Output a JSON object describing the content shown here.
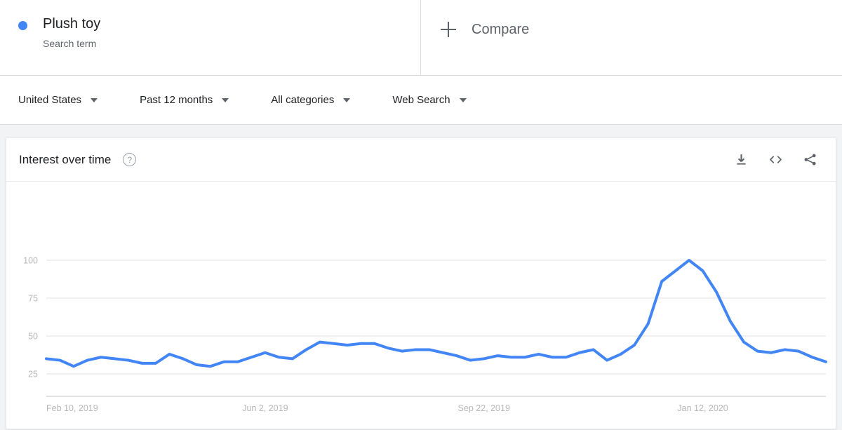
{
  "term": {
    "name": "Plush toy",
    "subtitle": "Search term",
    "dot_color": "#4285f4"
  },
  "compare": {
    "label": "Compare",
    "icon": "plus-icon"
  },
  "filters": [
    {
      "label": "United States"
    },
    {
      "label": "Past 12 months"
    },
    {
      "label": "All categories"
    },
    {
      "label": "Web Search"
    }
  ],
  "chart_card": {
    "title": "Interest over time",
    "help_icon": "question-mark-icon",
    "actions": [
      {
        "name": "download-icon"
      },
      {
        "name": "embed-icon",
        "glyph": "< >"
      },
      {
        "name": "share-icon"
      }
    ]
  },
  "chart_data": {
    "type": "line",
    "title": "Interest over time",
    "xlabel": "",
    "ylabel": "",
    "ylim": [
      0,
      108
    ],
    "yticks": [
      25,
      50,
      75,
      100
    ],
    "ytick_labels": [
      "25",
      "50",
      "75",
      "100"
    ],
    "grid": true,
    "legend": false,
    "line_color": "#4285f4",
    "line_width": 4,
    "xtick_labels": [
      "Feb 10, 2019",
      "Jun 2, 2019",
      "Sep 22, 2019",
      "Jan 12, 2020"
    ],
    "xtick_positions": [
      0,
      16,
      32,
      48
    ],
    "series": [
      {
        "name": "Plush toy",
        "values": [
          35,
          34,
          30,
          34,
          36,
          35,
          34,
          32,
          32,
          38,
          35,
          31,
          30,
          33,
          33,
          36,
          39,
          36,
          35,
          41,
          46,
          45,
          44,
          45,
          45,
          42,
          40,
          41,
          41,
          39,
          37,
          34,
          35,
          37,
          36,
          36,
          38,
          36,
          36,
          39,
          41,
          34,
          38,
          44,
          58,
          86,
          93,
          100,
          93,
          79,
          60,
          46,
          40,
          39,
          41,
          40,
          36,
          33
        ]
      }
    ]
  }
}
